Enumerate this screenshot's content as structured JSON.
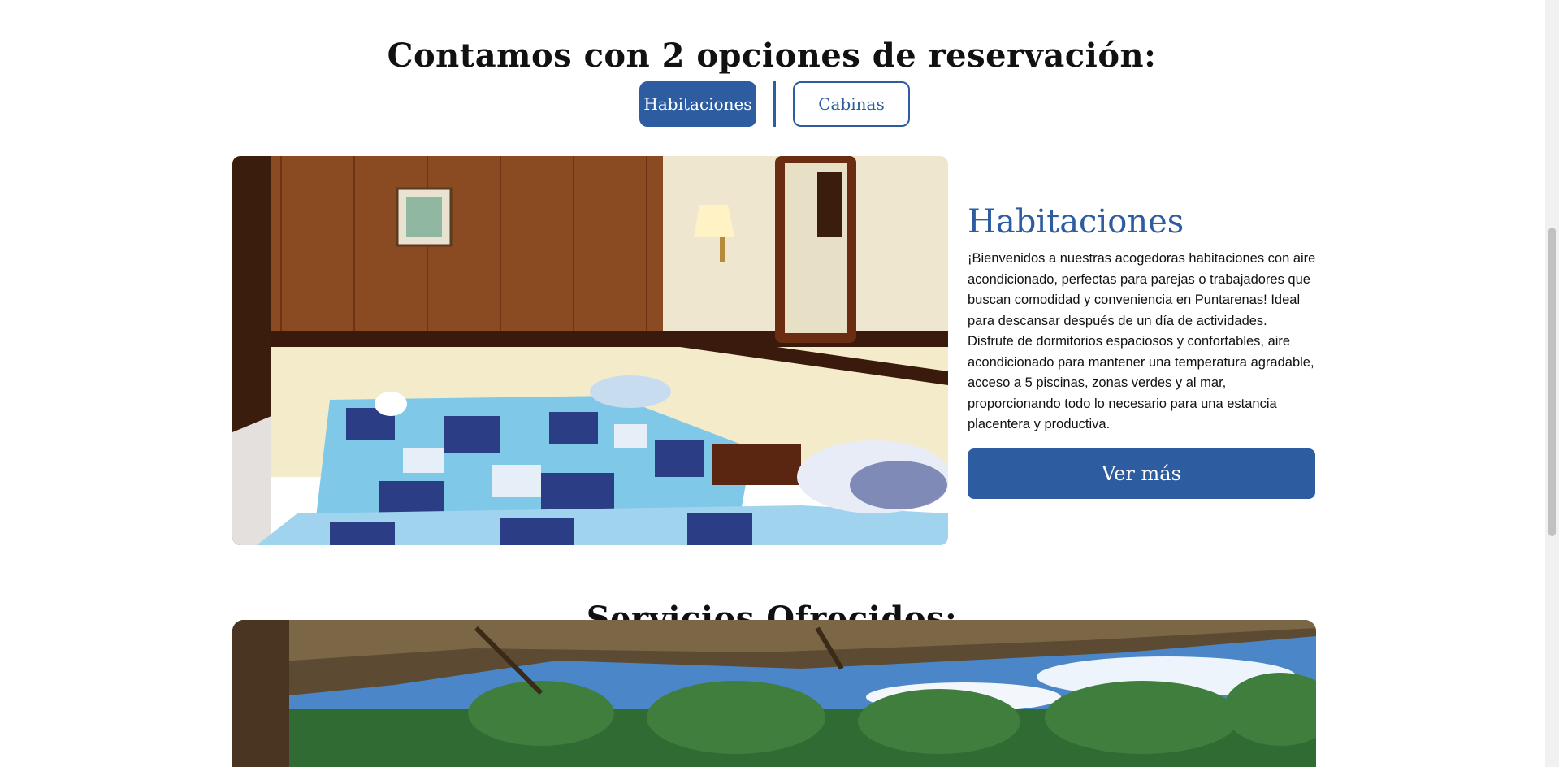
{
  "header": {
    "title": "Contamos con 2 opciones de reservación:"
  },
  "toggle": {
    "option_active": "Habitaciones",
    "option_inactive": "Cabinas"
  },
  "room": {
    "heading": "Habitaciones",
    "description": "¡Bienvenidos a nuestras acogedoras habitaciones con aire acondicionado, perfectas para parejas o trabajadores que buscan comodidad y conveniencia en Puntarenas! Ideal para descansar después de un día de actividades. Disfrute de dormitorios espaciosos y confortables, aire acondicionado para mantener una temperatura agradable, acceso a 5 piscinas, zonas verdes y al mar, proporcionando todo lo necesario para una estancia placentera y productiva.",
    "cta": "Ver más"
  },
  "services": {
    "title": "Servicios Ofrecidos:"
  },
  "colors": {
    "accent": "#2d5da0",
    "background": "#ffffff",
    "text": "#111111"
  }
}
